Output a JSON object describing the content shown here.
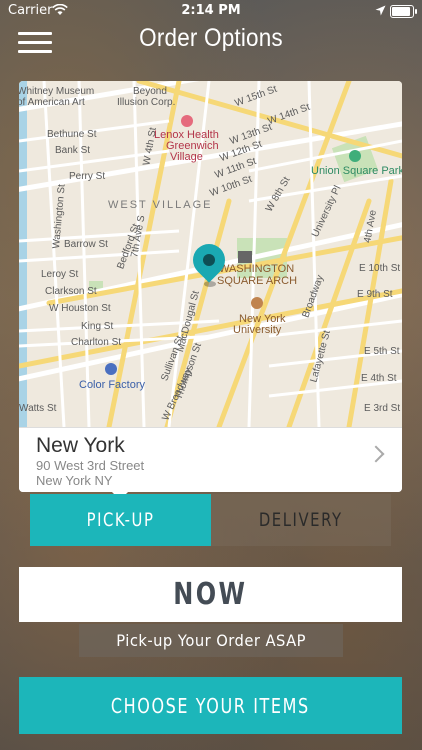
{
  "status_bar": {
    "carrier": "Carrier",
    "time": "2:14 PM"
  },
  "nav": {
    "title": "Order Options"
  },
  "map": {
    "labels": {
      "whitney": "Whitney Museum",
      "american_art": "of American Art",
      "beyond": "Beyond",
      "illusion": "Illusion Corp.",
      "lenox1": "Lenox Health",
      "lenox2": "Greenwich",
      "lenox3": "Village",
      "union_square": "Union Square Park",
      "west_village": "WEST VILLAGE",
      "washington1": "WASHINGTON",
      "washington2": "SQUARE ARCH",
      "nyu1": "New York",
      "nyu2": "University",
      "color_factory": "Color Factory",
      "w15": "W 15th St",
      "w14": "W 14th St",
      "w13": "W 13th St",
      "w12": "W 12th St",
      "w11": "W 11th St",
      "w10": "W 10th St",
      "w4": "W 4th St",
      "w8": "W 8th St",
      "bethune": "Bethune St",
      "bank": "Bank St",
      "perry": "Perry St",
      "washington_st": "Washington St",
      "barrow": "Barrow St",
      "leroy": "Leroy St",
      "clarkson": "Clarkson St",
      "w_houston": "W Houston St",
      "king": "King St",
      "charlton": "Charlton St",
      "watts": "Watts St",
      "seventh_ave": "7th Ave S",
      "bedford": "Bedford St",
      "macdougal": "MacDougal St",
      "sullivan": "Sullivan St",
      "thompson": "Thompson St",
      "w_broadway": "W Broadway",
      "broadway": "Broadway",
      "lafayette": "Lafayette St",
      "university_pl": "University Pl",
      "fourth_ave": "4th Ave",
      "e10": "E 10th St",
      "e9": "E 9th St",
      "e5": "E 5th St",
      "e4": "E 4th St",
      "e3": "E 3rd St"
    }
  },
  "location": {
    "city": "New York",
    "address_line1": "90 West 3rd Street",
    "address_line2": "New York NY"
  },
  "order_type": {
    "pickup_label": "PICK-UP",
    "delivery_label": "DELIVERY",
    "selected": "pickup"
  },
  "timing": {
    "value": "NOW",
    "note": "Pick-up Your Order ASAP"
  },
  "cta": {
    "label": "CHOOSE YOUR ITEMS"
  },
  "colors": {
    "accent": "#1cb6ba",
    "pin": "#1aa8b2"
  },
  "icons": [
    "wifi-icon",
    "location-arrow-icon",
    "battery-icon",
    "hamburger-menu-icon",
    "map-pin-icon",
    "chevron-right-icon"
  ]
}
